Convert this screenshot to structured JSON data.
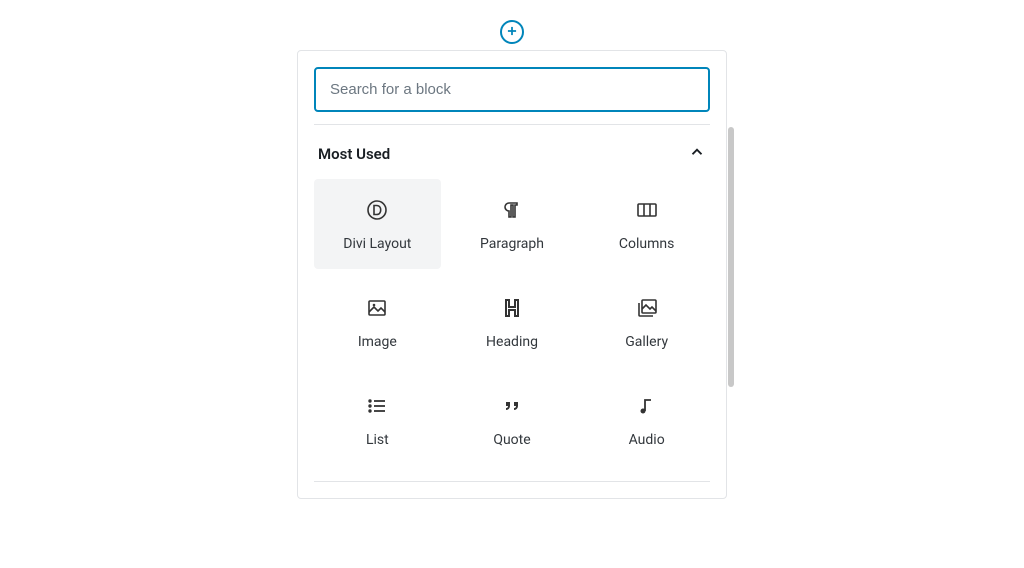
{
  "search": {
    "placeholder": "Search for a block"
  },
  "section": {
    "title": "Most Used"
  },
  "blocks": [
    {
      "icon": "divi",
      "label": "Divi Layout",
      "highlighted": true
    },
    {
      "icon": "paragraph",
      "label": "Paragraph",
      "highlighted": false
    },
    {
      "icon": "columns",
      "label": "Columns",
      "highlighted": false
    },
    {
      "icon": "image",
      "label": "Image",
      "highlighted": false
    },
    {
      "icon": "heading",
      "label": "Heading",
      "highlighted": false
    },
    {
      "icon": "gallery",
      "label": "Gallery",
      "highlighted": false
    },
    {
      "icon": "list",
      "label": "List",
      "highlighted": false
    },
    {
      "icon": "quote",
      "label": "Quote",
      "highlighted": false
    },
    {
      "icon": "audio",
      "label": "Audio",
      "highlighted": false
    }
  ]
}
